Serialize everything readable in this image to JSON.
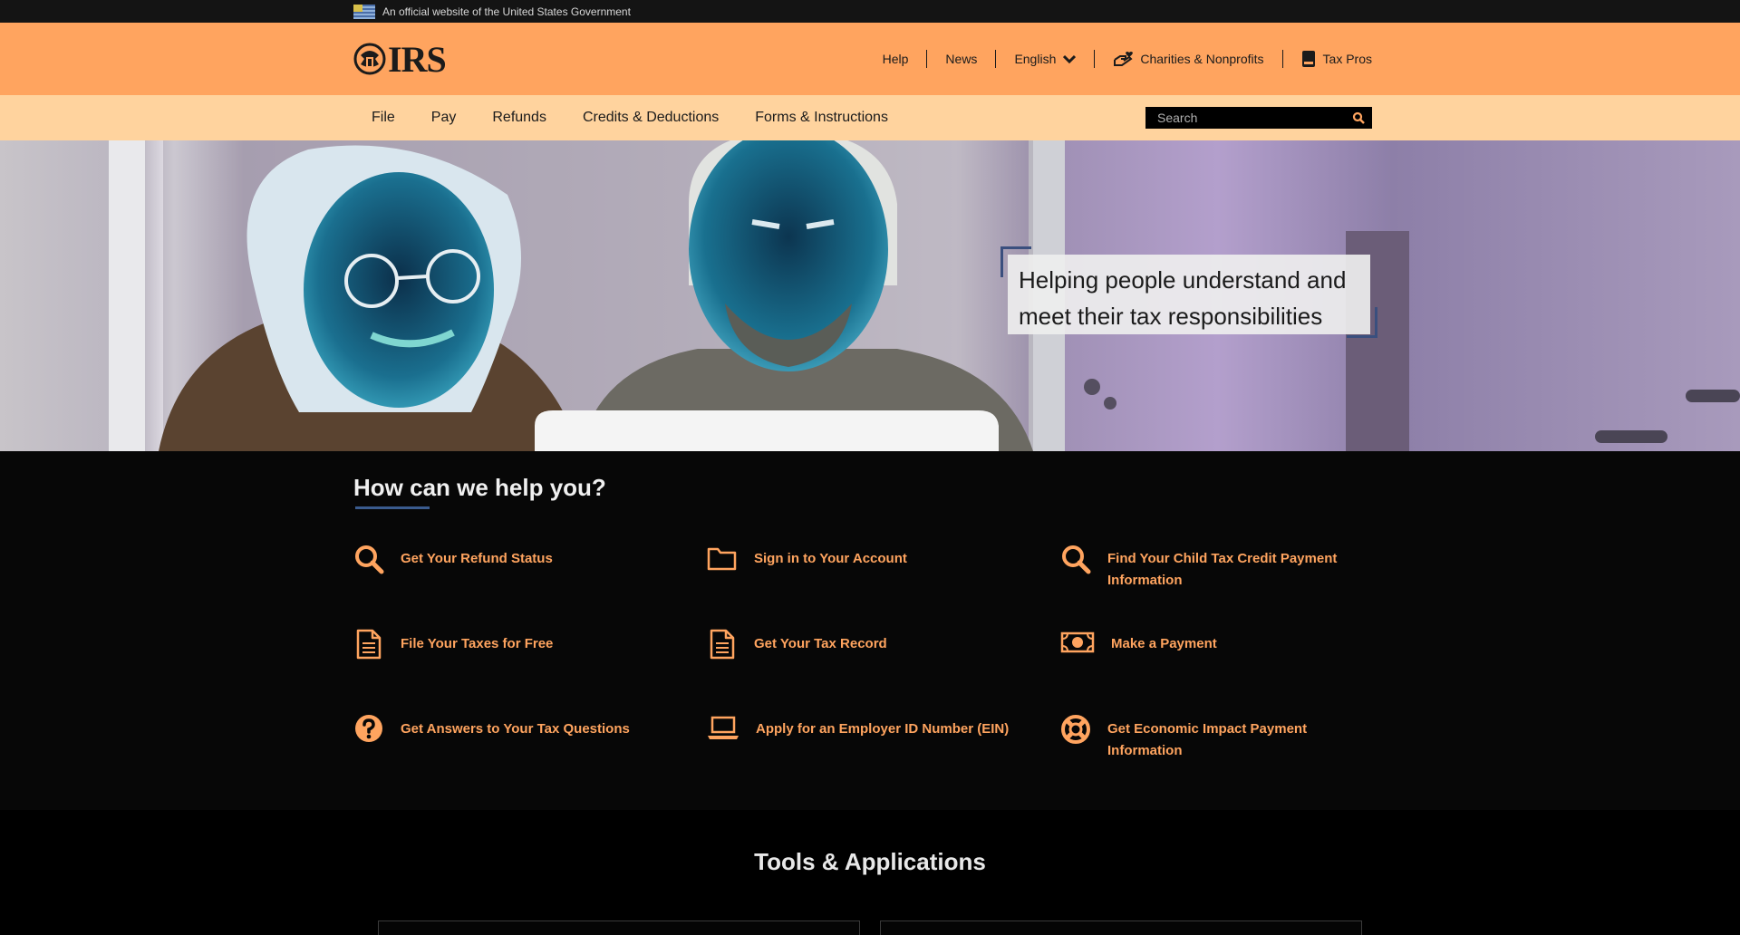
{
  "gov_banner": {
    "text": "An official website of the United States Government"
  },
  "header": {
    "logo_text": "IRS",
    "utility": [
      {
        "label": "Help"
      },
      {
        "label": "News"
      },
      {
        "label": "English"
      },
      {
        "label": "Charities & Nonprofits"
      },
      {
        "label": "Tax Pros"
      }
    ]
  },
  "nav": {
    "items": [
      "File",
      "Pay",
      "Refunds",
      "Credits & Deductions",
      "Forms & Instructions"
    ],
    "search_placeholder": "Search"
  },
  "hero": {
    "quote_line1": "Helping people understand and",
    "quote_line2": "meet their tax responsibilities"
  },
  "help": {
    "title": "How can we help you?",
    "tasks": [
      {
        "line1": "Get Your Refund Status",
        "line2": "",
        "icon": "search-icon"
      },
      {
        "line1": "Sign in to Your Account",
        "line2": "",
        "icon": "folder-icon"
      },
      {
        "line1": "Find Your Child Tax Credit Payment",
        "line2": "Information",
        "icon": "search-icon"
      },
      {
        "line1": "File Your Taxes for Free",
        "line2": "",
        "icon": "document-icon"
      },
      {
        "line1": "Get Your Tax Record",
        "line2": "",
        "icon": "document-icon"
      },
      {
        "line1": "Make a Payment",
        "line2": "",
        "icon": "money-icon"
      },
      {
        "line1": "Get Answers to Your Tax Questions",
        "line2": "",
        "icon": "question-icon"
      },
      {
        "line1": "Apply for an Employer ID Number (EIN)",
        "line2": "",
        "icon": "laptop-icon"
      },
      {
        "line1": "Get Economic Impact Payment",
        "line2": "Information",
        "icon": "lifebuoy-icon"
      }
    ]
  },
  "tools": {
    "title": "Tools & Applications"
  },
  "colors": {
    "accent": "#ffa45f",
    "nav_bg": "#ffd39e",
    "page_bg": "#070707",
    "bracket": "#3a4f7e"
  }
}
